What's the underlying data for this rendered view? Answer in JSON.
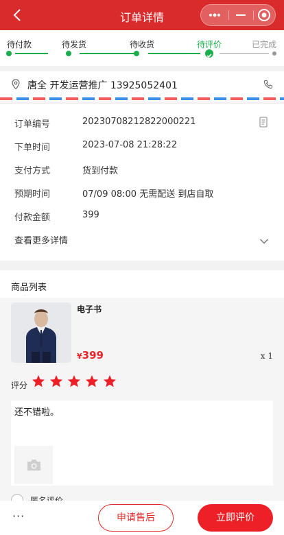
{
  "header": {
    "title": "订单详情",
    "icons": [
      "back-icon",
      "more-dots-icon",
      "minimize-icon",
      "target-icon"
    ],
    "color": "#d92b2b"
  },
  "steps": [
    {
      "label": "待付款",
      "state": "done"
    },
    {
      "label": "待发货",
      "state": "done"
    },
    {
      "label": "待收货",
      "state": "done"
    },
    {
      "label": "待评价",
      "state": "current"
    },
    {
      "label": "已完成",
      "state": "pending"
    }
  ],
  "address": {
    "text": "唐全 开发运营推广 13925052401",
    "icons": [
      "location-icon",
      "phone-icon"
    ]
  },
  "order_info": {
    "rows": [
      {
        "key": "订单编号",
        "value": "20230708212822000221"
      },
      {
        "key": "下单时间",
        "value": "2023-07-08 21:28:22"
      },
      {
        "key": "支付方式",
        "value": "货到付款"
      },
      {
        "key": "预期时间",
        "value": "07/09 08:00 无需配送 到店自取"
      },
      {
        "key": "付款金额",
        "value": "399"
      }
    ],
    "more_label": "查看更多详情"
  },
  "goods": {
    "title": "商品列表",
    "item": {
      "name": "电子书",
      "currency": "¥",
      "price": "399",
      "qty": "x 1"
    },
    "rating_label": "评分",
    "rating": 5,
    "review_text": "还不错啦。",
    "anonymous_label": "匿名评价"
  },
  "bottom": {
    "more_label": "···",
    "after_sale_label": "申请售后",
    "rate_label": "立即评价"
  },
  "colors": {
    "accent": "#ec2026",
    "green": "#1aad4b"
  }
}
